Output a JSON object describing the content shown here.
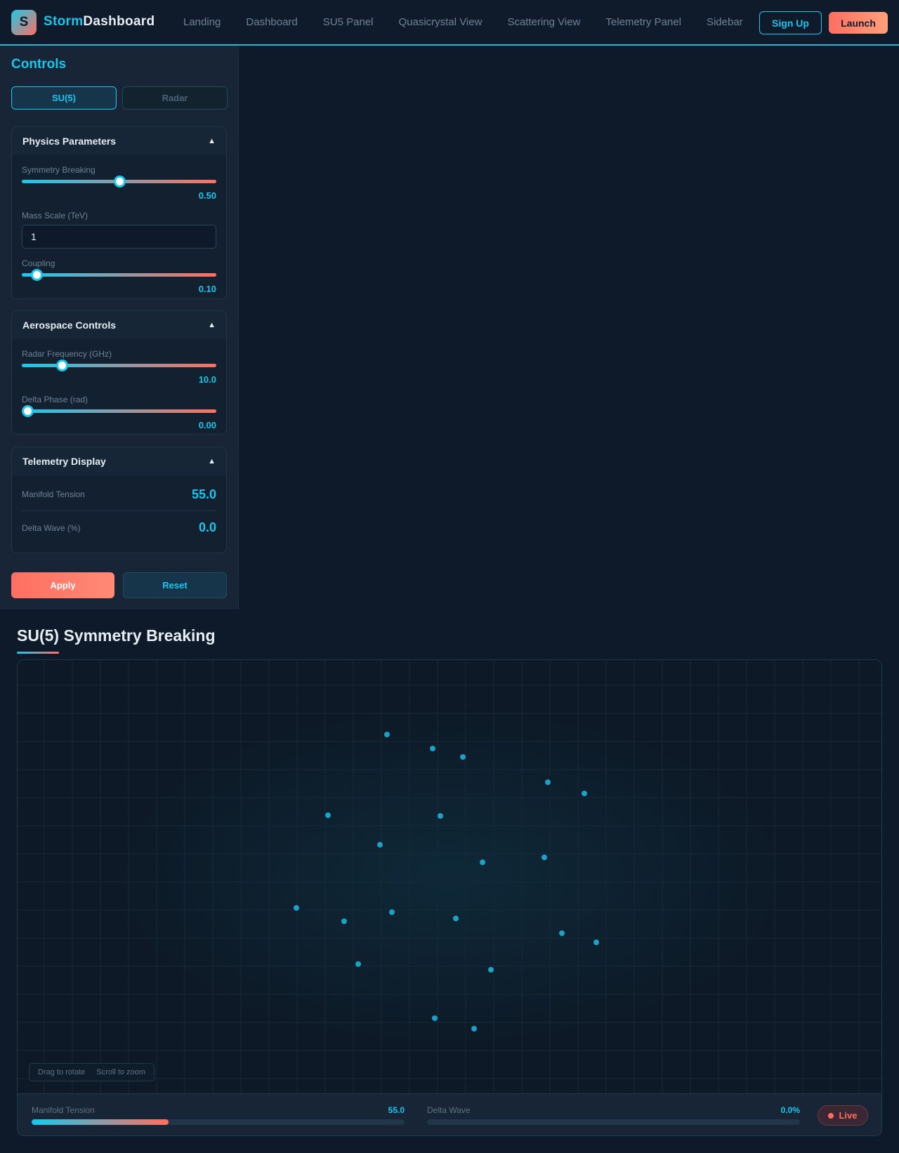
{
  "header": {
    "logo_letter": "S",
    "brand_part1": "Storm",
    "brand_part2": "Dashboard",
    "nav": [
      "Landing",
      "Dashboard",
      "SU5 Panel",
      "Quasicrystal View",
      "Scattering View",
      "Telemetry Panel",
      "Sidebar"
    ],
    "signup_label": "Sign Up",
    "launch_label": "Launch"
  },
  "sidebar": {
    "title": "Controls",
    "tabs": [
      {
        "label": "SU(5)",
        "active": true
      },
      {
        "label": "Radar",
        "active": false
      }
    ],
    "physics": {
      "title": "Physics Parameters",
      "symmetry_label": "Symmetry Breaking",
      "symmetry_value": "0.50",
      "symmetry_fraction": 0.5,
      "mass_label": "Mass Scale (TeV)",
      "mass_value": "1",
      "coupling_label": "Coupling",
      "coupling_value": "0.10",
      "coupling_fraction": 0.075
    },
    "aerospace": {
      "title": "Aerospace Controls",
      "radar_label": "Radar Frequency (GHz)",
      "radar_value": "10.0",
      "radar_fraction": 0.205,
      "phase_label": "Delta Phase (rad)",
      "phase_value": "0.00",
      "phase_fraction": 0.03
    },
    "telemetry": {
      "title": "Telemetry Display",
      "tension_label": "Manifold Tension",
      "tension_value": "55.0",
      "wave_label": "Delta Wave (%)",
      "wave_value": "0.0"
    },
    "apply_label": "Apply",
    "reset_label": "Reset"
  },
  "main": {
    "title": "SU(5) Symmetry Breaking",
    "hint_rotate": "Drag to rotate",
    "hint_zoom": "Scroll to zoom",
    "stats": {
      "tension_label": "Manifold Tension",
      "tension_value": "55.0",
      "tension_fraction": 0.367,
      "wave_label": "Delta Wave",
      "wave_value": "0.0%",
      "wave_fraction": 0.0
    },
    "live_label": "Live"
  },
  "colors": {
    "accent": "#19c8ee",
    "secondary": "#ff6f61",
    "background": "#0e1a29"
  }
}
